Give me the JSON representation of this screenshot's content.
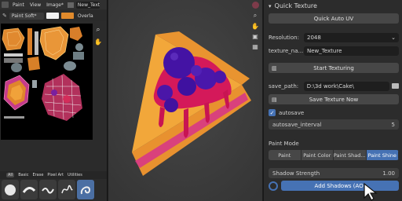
{
  "left_panel": {
    "menus": [
      "Paint",
      "View",
      "Image*"
    ],
    "texture_name": "New_Textu",
    "brush_name": "Paint Soft*",
    "color": "#e08a2c",
    "overlay": "Overla",
    "brush_tabs": [
      "All",
      "Basic",
      "Erase",
      "Pixel Art",
      "Utilities"
    ],
    "brushes": [
      "circle-brush",
      "soft-brush",
      "stroke-brush",
      "script-brush",
      "swirl-brush"
    ]
  },
  "right_panel": {
    "title": "Quick Texture",
    "quick_auto_uv": "Quick Auto UV",
    "resolution_label": "Resolution:",
    "resolution_value": "2048",
    "texture_name_label": "texture_na...",
    "texture_name_value": "New_Texture",
    "start_texturing": "Start Texturing",
    "save_path_label": "save_path:",
    "save_path_value": "D:\\3d work\\Cake\\",
    "save_texture_now": "Save Texture Now",
    "autosave_label": "autosave",
    "autosave_interval_label": "autosave_interval",
    "autosave_interval_value": "5",
    "paint_mode_label": "Paint Mode",
    "paint_modes": [
      "Paint",
      "Paint Color",
      "Paint Shad...",
      "Paint Shine"
    ],
    "active_paint_mode": "Paint Shine",
    "shadow_strength_label": "Shadow Strength",
    "shadow_strength_value": "1.00",
    "add_shadows": "Add Shadows (AO)"
  },
  "colors": {
    "accent": "#4672b4",
    "cake_orange": "#f0a23a",
    "berry_purple": "#4a15a8",
    "sauce_red": "#d4195a"
  }
}
